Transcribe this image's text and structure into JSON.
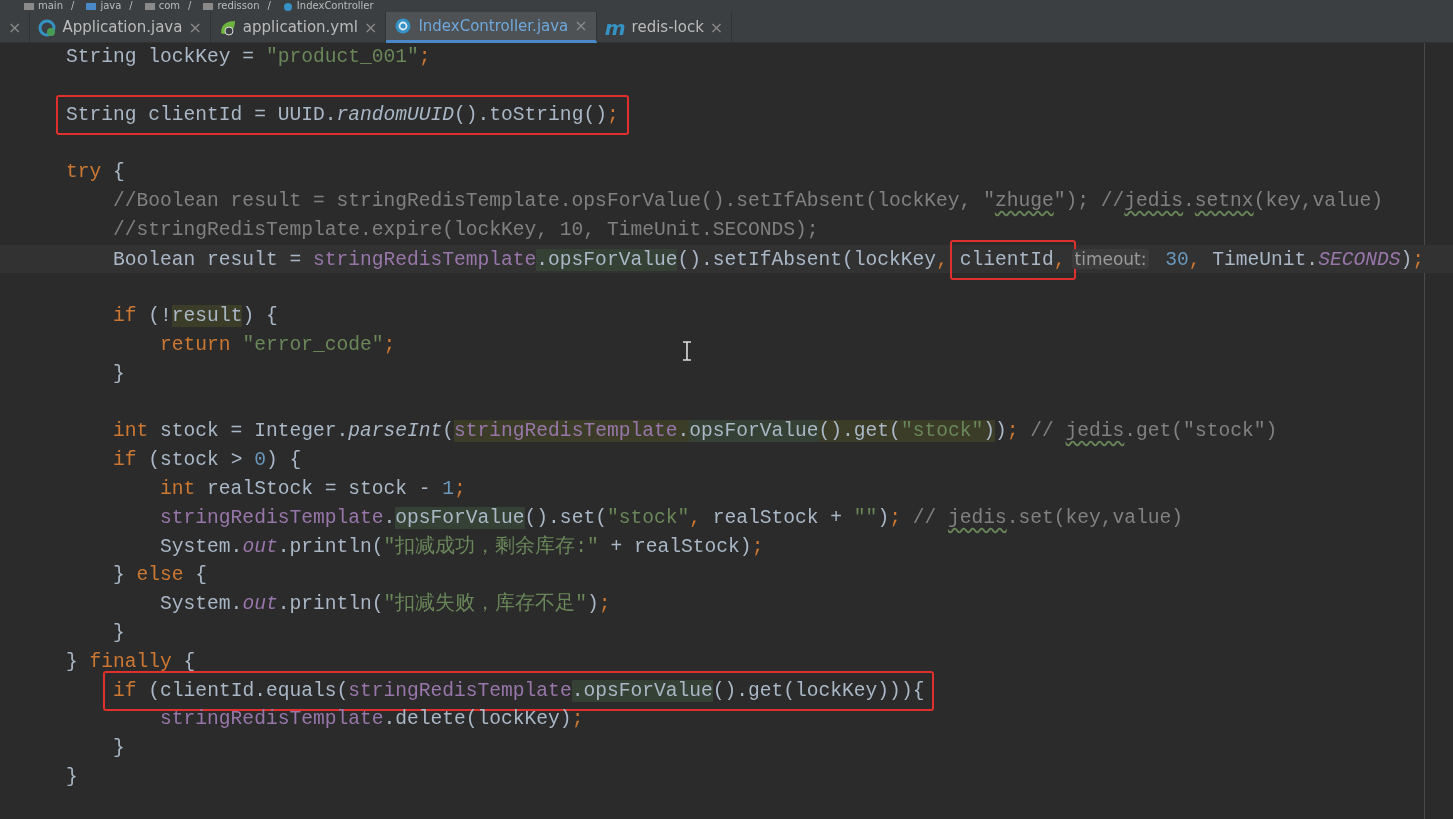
{
  "breadcrumb": {
    "separator": "/",
    "items": [
      {
        "label": "main",
        "kind": "folder"
      },
      {
        "label": "java",
        "kind": "source-folder"
      },
      {
        "label": "com",
        "kind": "folder"
      },
      {
        "label": "redisson",
        "kind": "folder"
      },
      {
        "label": "IndexController",
        "kind": "class"
      }
    ]
  },
  "tabs": [
    {
      "close": "×",
      "selected": false
    },
    {
      "label": "Application.java",
      "kind": "app",
      "close": "×",
      "selected": false
    },
    {
      "label": "application.yml",
      "kind": "yml",
      "close": "×",
      "selected": false
    },
    {
      "label": "IndexController.java",
      "kind": "class",
      "close": "×",
      "selected": true
    },
    {
      "label": "redis-lock",
      "kind": "maven",
      "glyph": "m",
      "close": "×",
      "selected": false
    }
  ],
  "editor": {
    "lines": [
      {
        "current": false,
        "segments": [
          {
            "boxed": false,
            "tokens": [
              {
                "text": "String lockKey = ",
                "kind": "plain"
              },
              {
                "text": "\"product_001\"",
                "kind": "string"
              },
              {
                "text": ";",
                "kind": "keyword"
              }
            ]
          }
        ]
      },
      {
        "current": false
      },
      {
        "current": false,
        "segments": [
          {
            "boxed": true,
            "tokens": [
              {
                "text": "String clientId = UUID.",
                "kind": "plain"
              },
              {
                "text": "randomUUID",
                "kind": "static"
              },
              {
                "text": "().toString()",
                "kind": "plain"
              },
              {
                "text": ";",
                "kind": "keyword"
              }
            ]
          }
        ]
      },
      {
        "current": false
      },
      {
        "current": false,
        "segments": [
          {
            "boxed": false,
            "tokens": [
              {
                "text": "try",
                "kind": "keyword"
              },
              {
                "text": " {",
                "kind": "plain"
              }
            ]
          }
        ]
      },
      {
        "current": false,
        "segments": [
          {
            "boxed": false,
            "tokens": [
              {
                "text": "    //Boolean result = stringRedisTemplate.opsForValue().setIfAbsent(lockKey, \"",
                "kind": "comment"
              },
              {
                "text": "zhuge",
                "kind": "comment",
                "typo": true
              },
              {
                "text": "\"); //",
                "kind": "comment"
              },
              {
                "text": "jedis",
                "kind": "comment",
                "typo": true
              },
              {
                "text": ".",
                "kind": "comment"
              },
              {
                "text": "setnx",
                "kind": "comment",
                "typo": true
              },
              {
                "text": "(key,value)",
                "kind": "comment"
              }
            ]
          }
        ]
      },
      {
        "current": false,
        "segments": [
          {
            "boxed": false,
            "tokens": [
              {
                "text": "    //stringRedisTemplate.expire(lockKey, 10, TimeUnit.SECONDS);",
                "kind": "comment"
              }
            ]
          }
        ]
      },
      {
        "current": true,
        "segments": [
          {
            "boxed": false,
            "tokens": [
              {
                "text": "    Boolean result = ",
                "kind": "plain"
              },
              {
                "text": "stringRedisTemplate",
                "kind": "field"
              },
              {
                "text": ".opsForValue",
                "kind": "plain",
                "highlight": true
              },
              {
                "text": "().setIfAbsent(lockKey",
                "kind": "plain"
              },
              {
                "text": ", ",
                "kind": "keyword"
              }
            ]
          },
          {
            "boxed": true,
            "tokens": [
              {
                "text": "clientId",
                "kind": "plain"
              },
              {
                "text": ",",
                "kind": "keyword"
              }
            ]
          },
          {
            "boxed": false,
            "tokens": [
              {
                "text": "timeout:",
                "kind": "hint"
              }
            ]
          },
          {
            "boxed": false,
            "tokens": [
              {
                "text": " 30",
                "kind": "number"
              },
              {
                "text": ", ",
                "kind": "keyword"
              },
              {
                "text": "TimeUnit.",
                "kind": "plain"
              },
              {
                "text": "SECONDS",
                "kind": "static_field"
              },
              {
                "text": ")",
                "kind": "plain"
              },
              {
                "text": ";",
                "kind": "keyword"
              }
            ]
          }
        ]
      },
      {
        "current": false
      },
      {
        "current": false,
        "segments": [
          {
            "boxed": false,
            "tokens": [
              {
                "text": "    if",
                "kind": "keyword"
              },
              {
                "text": " (!",
                "kind": "plain"
              },
              {
                "text": "result",
                "kind": "plain",
                "search_match": true
              },
              {
                "text": ") {",
                "kind": "plain"
              }
            ]
          }
        ]
      },
      {
        "current": false,
        "segments": [
          {
            "boxed": false,
            "tokens": [
              {
                "text": "        return",
                "kind": "keyword"
              },
              {
                "text": " \"error_code\"",
                "kind": "string"
              },
              {
                "text": ";",
                "kind": "keyword"
              }
            ]
          }
        ]
      },
      {
        "current": false,
        "segments": [
          {
            "boxed": false,
            "tokens": [
              {
                "text": "    }",
                "kind": "plain"
              }
            ]
          }
        ]
      },
      {
        "current": false
      },
      {
        "current": false,
        "segments": [
          {
            "boxed": false,
            "tokens": [
              {
                "text": "    int",
                "kind": "keyword"
              },
              {
                "text": " stock = Integer.",
                "kind": "plain"
              },
              {
                "text": "parseInt",
                "kind": "static"
              },
              {
                "text": "(",
                "kind": "plain"
              },
              {
                "text": "stringRedisTemplate",
                "kind": "field",
                "search_match": true
              },
              {
                "text": ".",
                "kind": "plain",
                "search_match": true
              },
              {
                "text": "opsForValue",
                "kind": "plain",
                "highlight": true
              },
              {
                "text": "().get(",
                "kind": "plain",
                "search_match": true
              },
              {
                "text": "\"stock\"",
                "kind": "string",
                "search_match": true
              },
              {
                "text": ")",
                "kind": "plain",
                "search_match": true
              },
              {
                "text": ")",
                "kind": "plain"
              },
              {
                "text": ";",
                "kind": "keyword"
              },
              {
                "text": " // ",
                "kind": "comment"
              },
              {
                "text": "jedis",
                "kind": "comment",
                "typo": true
              },
              {
                "text": ".get(\"stock\")",
                "kind": "comment"
              }
            ]
          }
        ]
      },
      {
        "current": false,
        "segments": [
          {
            "boxed": false,
            "tokens": [
              {
                "text": "    if",
                "kind": "keyword"
              },
              {
                "text": " (stock > ",
                "kind": "plain"
              },
              {
                "text": "0",
                "kind": "number"
              },
              {
                "text": ") {",
                "kind": "plain"
              }
            ]
          }
        ]
      },
      {
        "current": false,
        "segments": [
          {
            "boxed": false,
            "tokens": [
              {
                "text": "        int",
                "kind": "keyword"
              },
              {
                "text": " realStock = stock - ",
                "kind": "plain"
              },
              {
                "text": "1",
                "kind": "number"
              },
              {
                "text": ";",
                "kind": "keyword"
              }
            ]
          }
        ]
      },
      {
        "current": false,
        "segments": [
          {
            "boxed": false,
            "tokens": [
              {
                "text": "        stringRedisTemplate",
                "kind": "field"
              },
              {
                "text": ".",
                "kind": "plain"
              },
              {
                "text": "opsForValue",
                "kind": "plain",
                "highlight": true
              },
              {
                "text": "().set(",
                "kind": "plain"
              },
              {
                "text": "\"stock\"",
                "kind": "string"
              },
              {
                "text": ",",
                "kind": "keyword"
              },
              {
                "text": " realStock + ",
                "kind": "plain"
              },
              {
                "text": "\"\"",
                "kind": "string"
              },
              {
                "text": ")",
                "kind": "plain"
              },
              {
                "text": ";",
                "kind": "keyword"
              },
              {
                "text": " // ",
                "kind": "comment"
              },
              {
                "text": "jedis",
                "kind": "comment",
                "typo": true
              },
              {
                "text": ".set(key,value)",
                "kind": "comment"
              }
            ]
          }
        ]
      },
      {
        "current": false,
        "segments": [
          {
            "boxed": false,
            "tokens": [
              {
                "text": "        System.",
                "kind": "plain"
              },
              {
                "text": "out",
                "kind": "static_field"
              },
              {
                "text": ".println(",
                "kind": "plain"
              },
              {
                "text": "\"扣减成功，剩余库存:\"",
                "kind": "string"
              },
              {
                "text": " + realStock)",
                "kind": "plain"
              },
              {
                "text": ";",
                "kind": "keyword"
              }
            ]
          }
        ]
      },
      {
        "current": false,
        "segments": [
          {
            "boxed": false,
            "tokens": [
              {
                "text": "    } ",
                "kind": "plain"
              },
              {
                "text": "else",
                "kind": "keyword"
              },
              {
                "text": " {",
                "kind": "plain"
              }
            ]
          }
        ]
      },
      {
        "current": false,
        "segments": [
          {
            "boxed": false,
            "tokens": [
              {
                "text": "        System.",
                "kind": "plain"
              },
              {
                "text": "out",
                "kind": "static_field"
              },
              {
                "text": ".println(",
                "kind": "plain"
              },
              {
                "text": "\"扣减失败，库存不足\"",
                "kind": "string"
              },
              {
                "text": ")",
                "kind": "plain"
              },
              {
                "text": ";",
                "kind": "keyword"
              }
            ]
          }
        ]
      },
      {
        "current": false,
        "segments": [
          {
            "boxed": false,
            "tokens": [
              {
                "text": "    }",
                "kind": "plain"
              }
            ]
          }
        ]
      },
      {
        "current": false,
        "segments": [
          {
            "boxed": false,
            "tokens": [
              {
                "text": "} ",
                "kind": "plain"
              },
              {
                "text": "finally",
                "kind": "keyword"
              },
              {
                "text": " {",
                "kind": "plain"
              }
            ]
          }
        ]
      },
      {
        "current": false,
        "segments": [
          {
            "boxed": true,
            "tokens": [
              {
                "text": "    if",
                "kind": "keyword"
              },
              {
                "text": " (clientId.equals(",
                "kind": "plain"
              },
              {
                "text": "stringRedisTemplate",
                "kind": "field"
              },
              {
                "text": ".opsForValue",
                "kind": "plain",
                "highlight": true
              },
              {
                "text": "().get(lockKey))){",
                "kind": "plain"
              }
            ]
          }
        ]
      },
      {
        "current": false,
        "segments": [
          {
            "boxed": false,
            "tokens": [
              {
                "text": "        stringRedisTemplate",
                "kind": "field"
              },
              {
                "text": ".delete(lockKey)",
                "kind": "plain"
              },
              {
                "text": ";",
                "kind": "keyword"
              }
            ]
          }
        ]
      },
      {
        "current": false,
        "segments": [
          {
            "boxed": false,
            "tokens": [
              {
                "text": "    }",
                "kind": "plain"
              }
            ]
          }
        ]
      },
      {
        "current": false,
        "segments": [
          {
            "boxed": false,
            "tokens": [
              {
                "text": "}",
                "kind": "plain"
              }
            ]
          }
        ]
      }
    ]
  }
}
